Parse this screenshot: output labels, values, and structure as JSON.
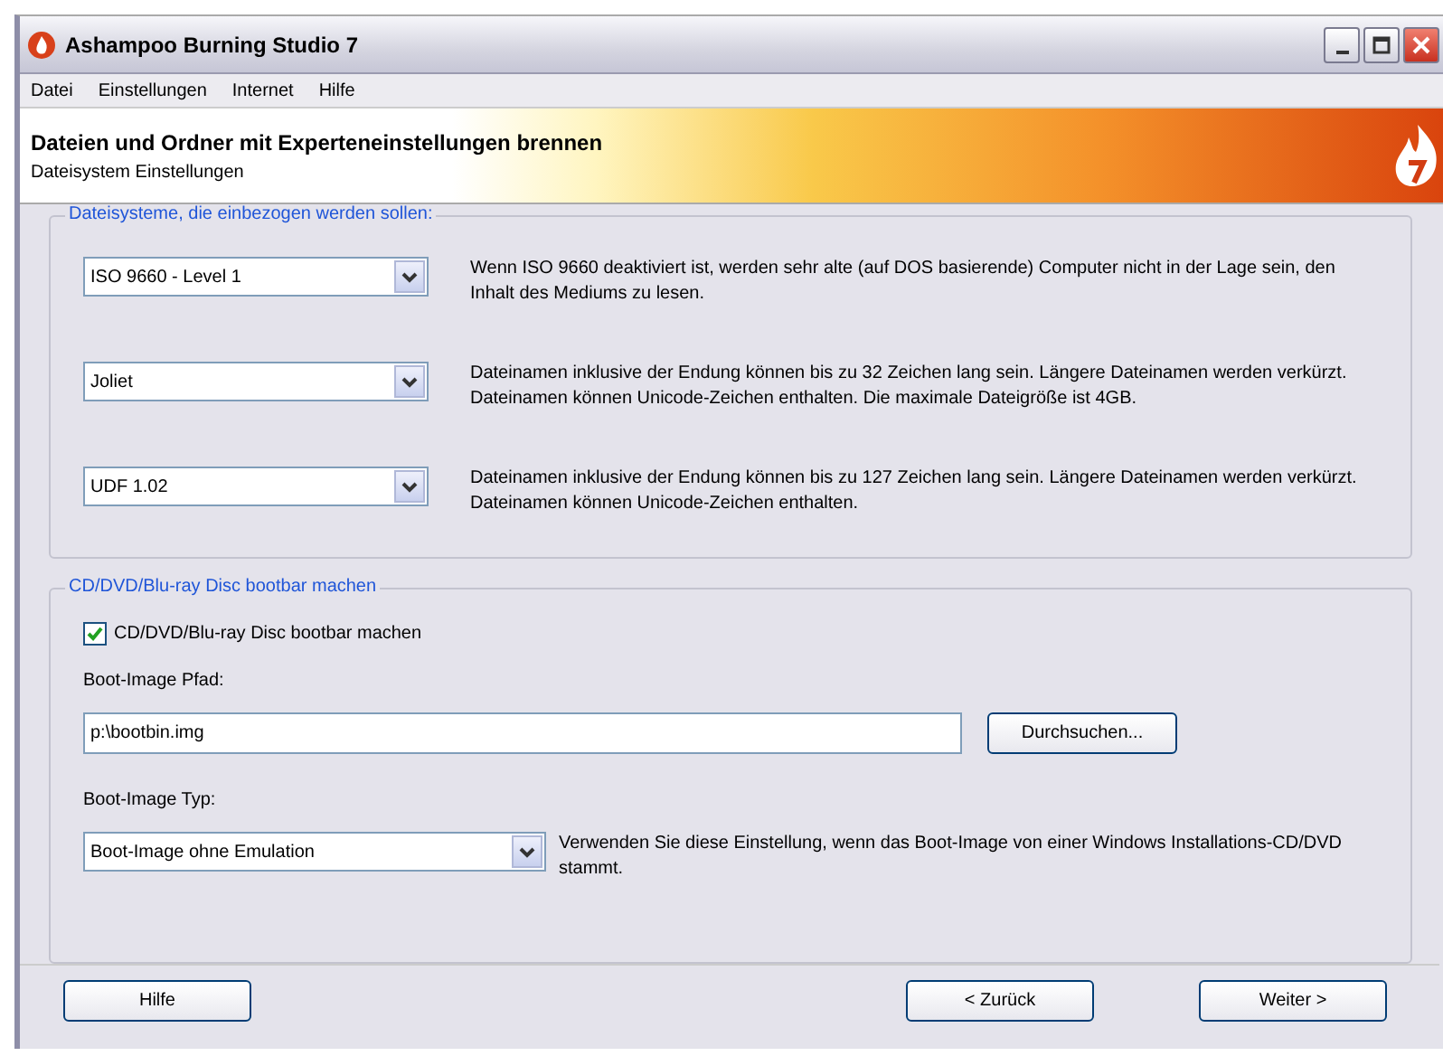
{
  "window": {
    "title": "Ashampoo Burning Studio 7"
  },
  "menu": [
    "Datei",
    "Einstellungen",
    "Internet",
    "Hilfe"
  ],
  "header": {
    "title": "Dateien und Ordner mit Experteneinstellungen brennen",
    "subtitle": "Dateisystem Einstellungen"
  },
  "filesystems": {
    "legend": "Dateisysteme, die einbezogen werden sollen:",
    "rows": [
      {
        "value": "ISO 9660 - Level 1",
        "description": "Wenn ISO 9660 deaktiviert ist, werden sehr alte (auf DOS basierende) Computer nicht in der Lage sein, den Inhalt des Mediums zu lesen."
      },
      {
        "value": "Joliet",
        "description": "Dateinamen inklusive der Endung können bis zu 32 Zeichen lang sein. Längere Dateinamen werden verkürzt. Dateinamen können Unicode-Zeichen enthalten. Die maximale Dateigröße ist 4GB."
      },
      {
        "value": "UDF 1.02",
        "description": "Dateinamen inklusive der Endung können bis zu 127 Zeichen lang sein. Längere Dateinamen werden verkürzt. Dateinamen können Unicode-Zeichen enthalten."
      }
    ]
  },
  "boot": {
    "legend": "CD/DVD/Blu-ray Disc bootbar machen",
    "checkbox": {
      "label": "CD/DVD/Blu-ray Disc bootbar machen",
      "checked": true
    },
    "path_label": "Boot-Image Pfad:",
    "path_value": "p:\\bootbin.img",
    "browse": "Durchsuchen...",
    "type_label": "Boot-Image Typ:",
    "type_value": "Boot-Image ohne Emulation",
    "type_description": "Verwenden Sie diese Einstellung, wenn das Boot-Image von einer Windows Installations-CD/DVD stammt."
  },
  "buttons": {
    "help": "Hilfe",
    "back": "< Zurück",
    "next": "Weiter >"
  }
}
